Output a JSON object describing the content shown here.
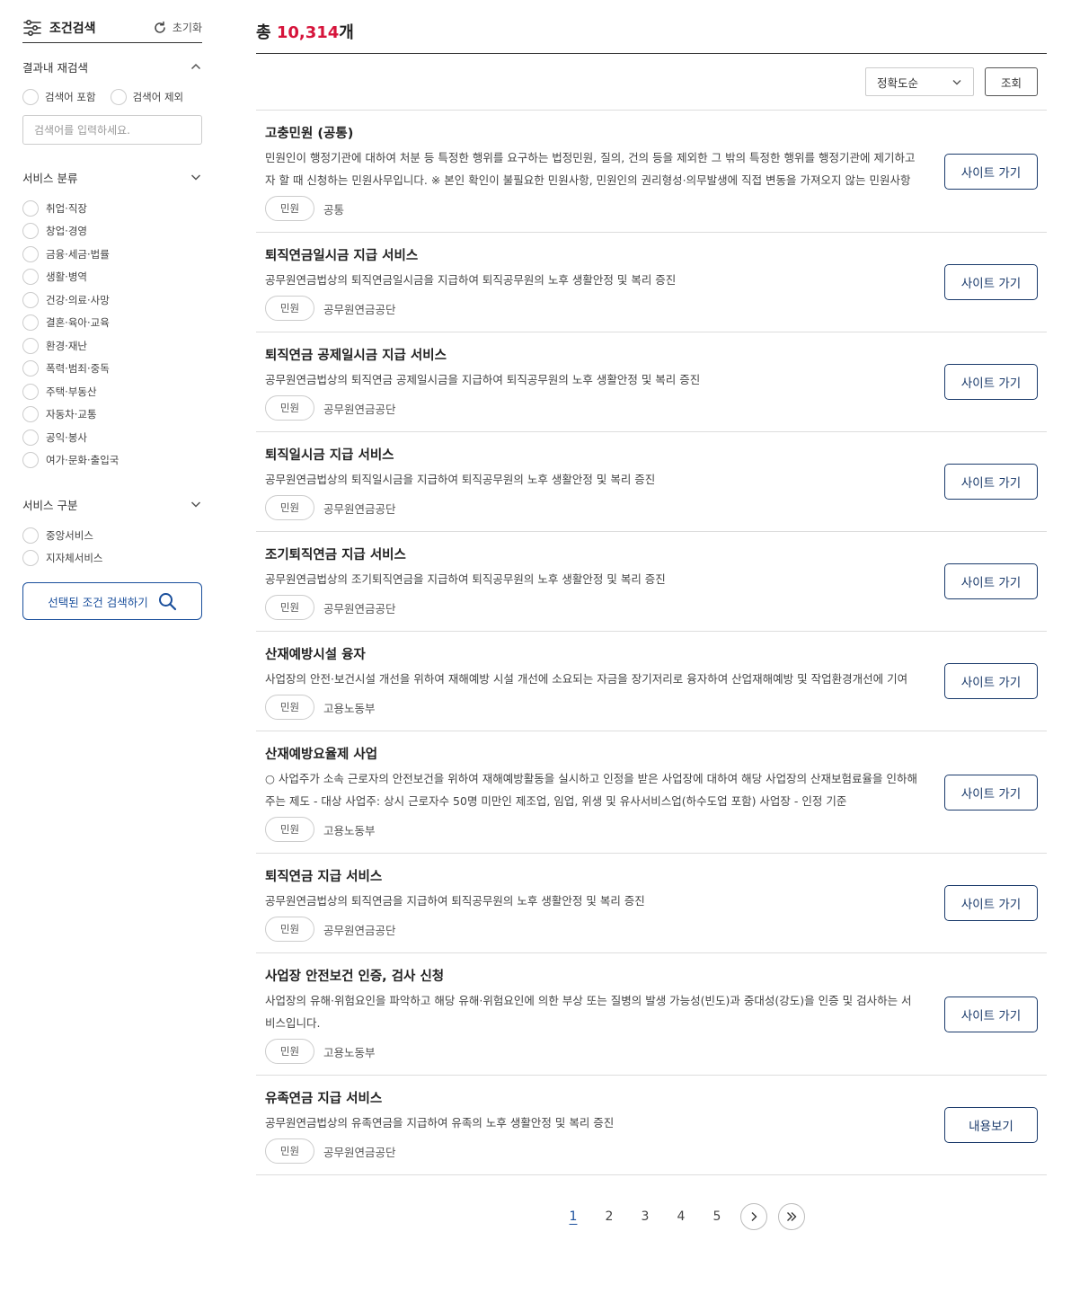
{
  "sidebar": {
    "title": "조건검색",
    "reset_label": "초기화",
    "refine": {
      "title": "결과내 재검색",
      "include_label": "검색어 포함",
      "exclude_label": "검색어 제외",
      "placeholder": "검색어를 입력하세요."
    },
    "service_category": {
      "title": "서비스 분류",
      "items": [
        "취업·직장",
        "창업·경영",
        "금융·세금·법률",
        "생활·병역",
        "건강·의료·사망",
        "결혼·육아·교육",
        "환경·재난",
        "폭력·범죄·중독",
        "주택·부동산",
        "자동차·교통",
        "공익·봉사",
        "여가·문화·출입국"
      ]
    },
    "service_type": {
      "title": "서비스 구분",
      "items": [
        "중앙서비스",
        "지자체서비스"
      ]
    },
    "search_button_label": "선택된 조건 검색하기"
  },
  "main": {
    "total_prefix": "총 ",
    "total_count": "10,314",
    "total_suffix": "개",
    "sort_selected": "정확도순",
    "query_label": "조회",
    "results": [
      {
        "title": "고충민원 (공통)",
        "desc": "민원인이 행정기관에 대하여 처분 등 특정한 행위를 요구하는 법정민원, 질의, 건의 등을 제외한 그 밖의 특정한 행위를 행정기관에 제기하고자 할 때 신청하는 민원사무입니다. ※ 본인 확인이 불필요한 민원사항, 민원인의 권리형성·의무발생에 직접 변동을 가져오지 않는 민원사항",
        "tag": "민원",
        "org": "공통",
        "button": "사이트 가기"
      },
      {
        "title": "퇴직연금일시금 지급 서비스",
        "desc": "공무원연금법상의 퇴직연금일시금을 지급하여 퇴직공무원의 노후 생활안정 및 복리 증진",
        "tag": "민원",
        "org": "공무원연금공단",
        "button": "사이트 가기"
      },
      {
        "title": "퇴직연금 공제일시금 지급 서비스",
        "desc": "공무원연금법상의 퇴직연금 공제일시금을 지급하여 퇴직공무원의 노후 생활안정 및 복리 증진",
        "tag": "민원",
        "org": "공무원연금공단",
        "button": "사이트 가기"
      },
      {
        "title": "퇴직일시금 지급 서비스",
        "desc": "공무원연금법상의 퇴직일시금을 지급하여 퇴직공무원의 노후 생활안정 및 복리 증진",
        "tag": "민원",
        "org": "공무원연금공단",
        "button": "사이트 가기"
      },
      {
        "title": "조기퇴직연금 지급 서비스",
        "desc": "공무원연금법상의 조기퇴직연금을 지급하여 퇴직공무원의 노후 생활안정 및 복리 증진",
        "tag": "민원",
        "org": "공무원연금공단",
        "button": "사이트 가기"
      },
      {
        "title": "산재예방시설 융자",
        "desc": "사업장의 안전·보건시설 개선을 위하여 재해예방 시설 개선에 소요되는 자금을 장기저리로 융자하여 산업재해예방 및 작업환경개선에 기여",
        "tag": "민원",
        "org": "고용노동부",
        "button": "사이트 가기"
      },
      {
        "title": "산재예방요율제 사업",
        "desc": "○ 사업주가 소속 근로자의 안전보건을 위하여 재해예방활동을 실시하고 인정을 받은 사업장에 대하여 해당 사업장의 산재보험료율을 인하해 주는 제도 - 대상 사업주: 상시 근로자수 50명 미만인 제조업, 임업, 위생 및 유사서비스업(하수도업 포함) 사업장 - 인정 기준",
        "tag": "민원",
        "org": "고용노동부",
        "button": "사이트 가기"
      },
      {
        "title": "퇴직연금 지급 서비스",
        "desc": "공무원연금법상의 퇴직연금을 지급하여 퇴직공무원의 노후 생활안정 및 복리 증진",
        "tag": "민원",
        "org": "공무원연금공단",
        "button": "사이트 가기"
      },
      {
        "title": "사업장 안전보건 인증, 검사 신청",
        "desc": "사업장의 유해·위험요인을 파악하고 해당 유해·위험요인에 의한 부상 또는 질병의 발생 가능성(빈도)과 중대성(강도)을 인증 및 검사하는 서비스입니다.",
        "tag": "민원",
        "org": "고용노동부",
        "button": "사이트 가기"
      },
      {
        "title": "유족연금 지급 서비스",
        "desc": "공무원연금법상의 유족연금을 지급하여 유족의 노후 생활안정 및 복리 증진",
        "tag": "민원",
        "org": "공무원연금공단",
        "button": "내용보기"
      }
    ],
    "pagination": {
      "pages": [
        "1",
        "2",
        "3",
        "4",
        "5"
      ],
      "current": "1"
    }
  },
  "colors": {
    "accent_red": "#d6143b",
    "brand_blue": "#1a4f9c",
    "button_navy": "#1a3a6b"
  }
}
